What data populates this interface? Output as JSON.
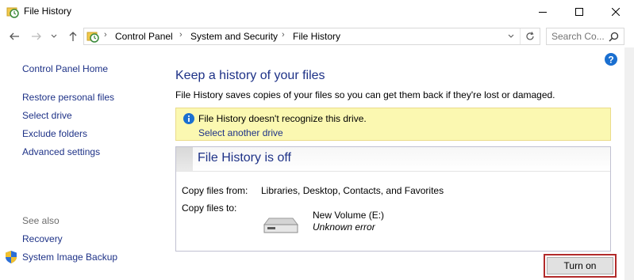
{
  "window": {
    "title": "File History"
  },
  "address": {
    "crumbs": [
      "Control Panel",
      "System and Security",
      "File History"
    ],
    "search_placeholder": "Search Co..."
  },
  "sidebar": {
    "home": "Control Panel Home",
    "items": [
      "Restore personal files",
      "Select drive",
      "Exclude folders",
      "Advanced settings"
    ],
    "see_also_label": "See also",
    "see_also": [
      "Recovery",
      "System Image Backup"
    ]
  },
  "main": {
    "heading": "Keep a history of your files",
    "description": "File History saves copies of your files so you can get them back if they're lost or damaged.",
    "banner": {
      "message": "File History doesn't recognize this drive.",
      "link": "Select another drive"
    },
    "status_title": "File History is off",
    "copy_from_label": "Copy files from:",
    "copy_from_value": "Libraries, Desktop, Contacts, and Favorites",
    "copy_to_label": "Copy files to:",
    "drive_name": "New Volume (E:)",
    "drive_status": "Unknown error",
    "turn_on": "Turn on"
  },
  "colors": {
    "link": "#1e3287",
    "banner_bg": "#fbf8b1",
    "highlight_border": "#b22a2a",
    "info_icon": "#1a6fd0"
  },
  "icons": [
    "file-history-icon",
    "minimize-icon",
    "maximize-icon",
    "close-icon",
    "back-arrow-icon",
    "forward-arrow-icon",
    "chevron-down-icon",
    "up-arrow-icon",
    "refresh-icon",
    "search-icon",
    "help-icon",
    "info-icon",
    "shield-icon",
    "drive-icon"
  ]
}
